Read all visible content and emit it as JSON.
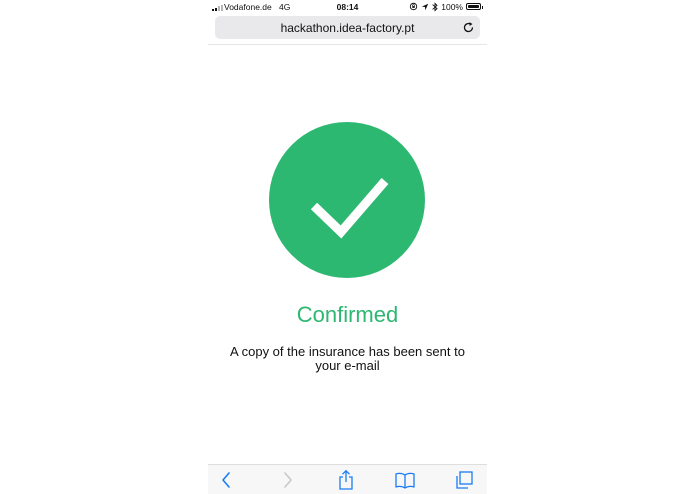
{
  "status_bar": {
    "carrier": "Vodafone.de",
    "network": "4G",
    "time": "08:14",
    "battery": "100%"
  },
  "browser": {
    "url": "hackathon.idea-factory.pt"
  },
  "main": {
    "title": "Confirmed",
    "message": "A copy of the insurance has been sent to your e-mail",
    "accent_color": "#2db872"
  },
  "toolbar": {
    "icons": [
      "back-icon",
      "forward-icon",
      "share-icon",
      "bookmarks-icon",
      "tabs-icon"
    ],
    "accent_color": "#1a7cf3"
  }
}
